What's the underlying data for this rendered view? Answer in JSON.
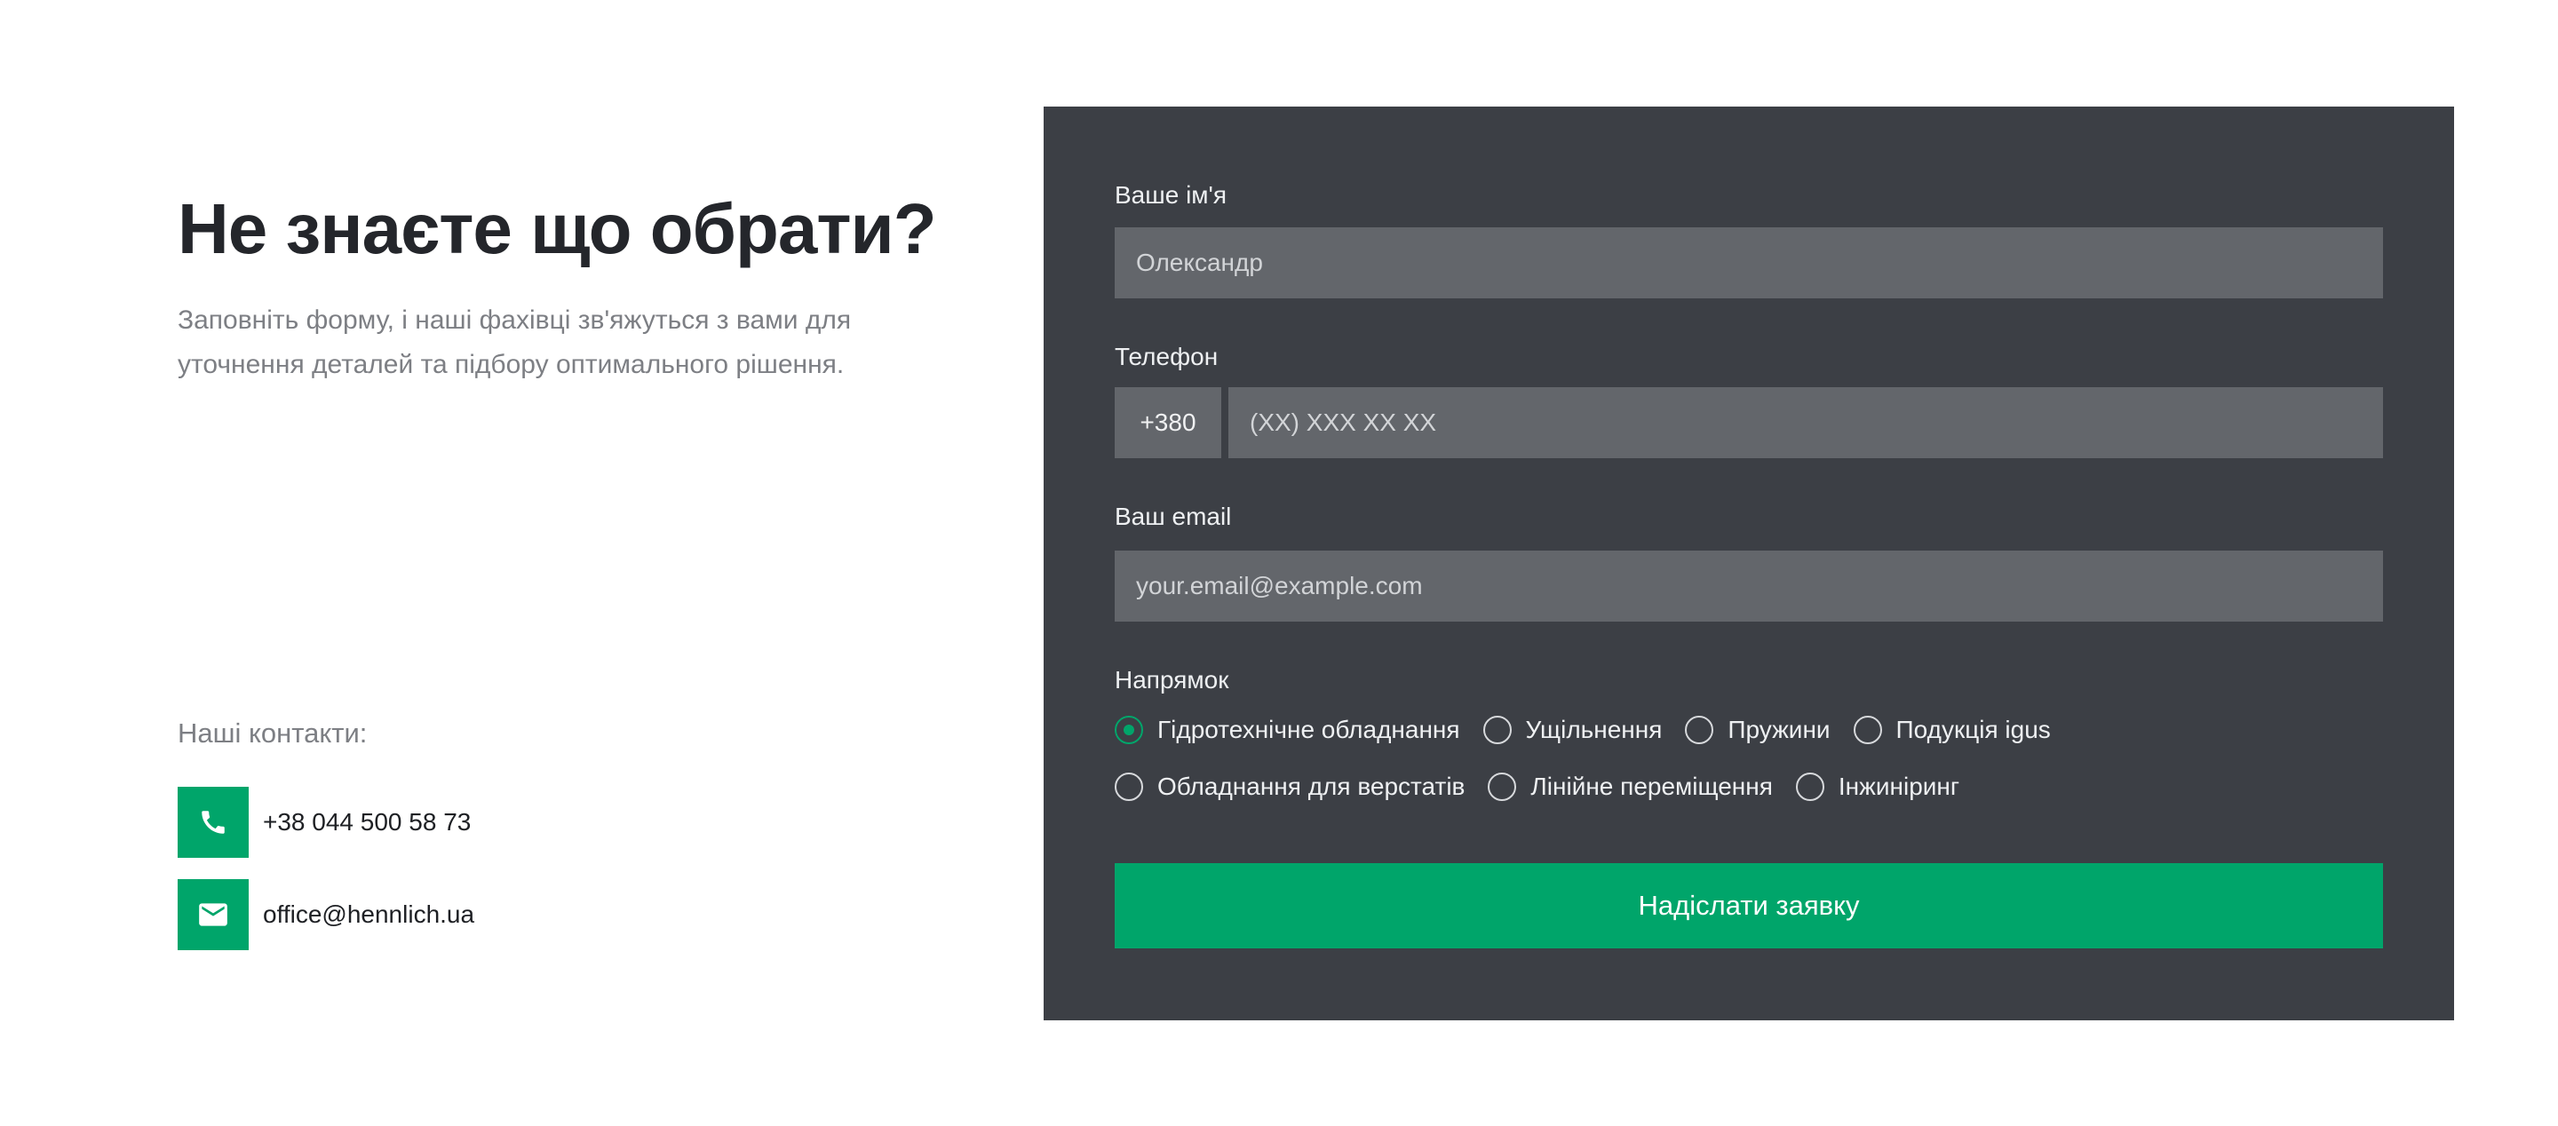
{
  "hero": {
    "title": "Не знаєте що обрати?",
    "subtitle": "Заповніть форму, і наші фахівці зв'яжуться з вами для уточнення деталей та підбору оптимального рішення."
  },
  "contacts": {
    "label": "Наші контакти:",
    "phone": "+38 044 500 58 73",
    "email": "office@hennlich.ua",
    "phone_icon": "phone-icon",
    "email_icon": "mail-icon"
  },
  "form": {
    "name": {
      "label": "Ваше ім'я",
      "placeholder": "Олександр",
      "value": ""
    },
    "phone": {
      "label": "Телефон",
      "prefix": "+380",
      "placeholder": "(XX) XXX XX XX",
      "value": ""
    },
    "email": {
      "label": "Ваш email",
      "placeholder": "your.email@example.com",
      "value": ""
    },
    "direction": {
      "label": "Напрямок",
      "selected": "Гідротехнічне обладнання",
      "options_row1": [
        "Гідротехнічне обладнання",
        "Ущільнення",
        "Пружини",
        "Подукція igus"
      ],
      "options_row2": [
        "Обладнання для верстатів",
        "Лінійне переміщення",
        "Інжиніринг"
      ]
    },
    "submit_label": "Надіслати заявку"
  },
  "colors": {
    "accent": "#00a56a",
    "panel_bg": "#3c3f45",
    "input_bg": "#63666b",
    "title": "#24262b",
    "muted_text": "#7d7f84"
  }
}
